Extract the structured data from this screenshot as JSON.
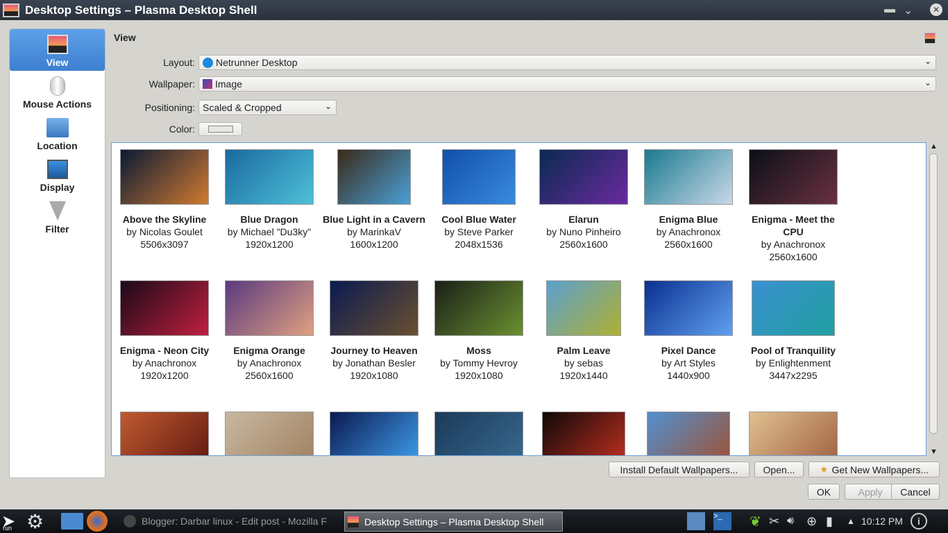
{
  "window": {
    "title": "Desktop Settings – Plasma Desktop Shell"
  },
  "sidebar": {
    "items": [
      {
        "label": "View",
        "icon": "monitor-wallpaper-icon"
      },
      {
        "label": "Mouse Actions",
        "icon": "mouse-icon"
      },
      {
        "label": "Location",
        "icon": "folder-icon"
      },
      {
        "label": "Display",
        "icon": "display-icon"
      },
      {
        "label": "Filter",
        "icon": "filter-icon"
      }
    ]
  },
  "main": {
    "heading": "View",
    "layout": {
      "label": "Layout:",
      "value": "Netrunner Desktop"
    },
    "wallpaper": {
      "label": "Wallpaper:",
      "value": "Image"
    },
    "positioning": {
      "label": "Positioning:",
      "value": "Scaled & Cropped"
    },
    "color": {
      "label": "Color:"
    }
  },
  "wallpapers": [
    {
      "name": "Above the Skyline",
      "author": "by Nicolas Goulet",
      "size": "5506x3097",
      "c": [
        "#0a1a35",
        "#d07a30"
      ]
    },
    {
      "name": "Blue Dragon",
      "author": "by Michael \"Du3ky\"",
      "size": "1920x1200",
      "c": [
        "#1a6aa0",
        "#4ec0d8"
      ]
    },
    {
      "name": "Blue Light in a Cavern",
      "author": "by MarinkaV",
      "size": "1600x1200",
      "c": [
        "#3a2a18",
        "#4aa0d8"
      ]
    },
    {
      "name": "Cool Blue Water",
      "author": "by Steve Parker",
      "size": "2048x1536",
      "c": [
        "#1050a8",
        "#3a8ae0"
      ]
    },
    {
      "name": "Elarun",
      "author": "by Nuno Pinheiro",
      "size": "2560x1600",
      "c": [
        "#0a2a50",
        "#6a2aa0"
      ]
    },
    {
      "name": "Enigma Blue",
      "author": "by Anachronox",
      "size": "2560x1600",
      "c": [
        "#1a7a90",
        "#c8d8e8"
      ]
    },
    {
      "name": "Enigma - Meet the CPU",
      "author": "by Anachronox",
      "size": "2560x1600",
      "c": [
        "#0a1018",
        "#6a3040"
      ]
    },
    {
      "name": "Enigma - Neon City",
      "author": "by Anachronox",
      "size": "1920x1200",
      "c": [
        "#1a0a18",
        "#c02040"
      ]
    },
    {
      "name": "Enigma Orange",
      "author": "by Anachronox",
      "size": "2560x1600",
      "c": [
        "#5a3a80",
        "#e0a080"
      ]
    },
    {
      "name": "Journey to Heaven",
      "author": "by Jonathan Besler",
      "size": "1920x1080",
      "c": [
        "#0a1a50",
        "#6a5030"
      ]
    },
    {
      "name": "Moss",
      "author": "by Tommy Hevroy",
      "size": "1920x1080",
      "c": [
        "#1a2018",
        "#6a9030"
      ]
    },
    {
      "name": "Palm Leave",
      "author": "by sebas",
      "size": "1920x1440",
      "c": [
        "#5aa0d0",
        "#b0b030"
      ]
    },
    {
      "name": "Pixel Dance",
      "author": "by Art Styles",
      "size": "1440x900",
      "c": [
        "#0a3090",
        "#60a0f0"
      ]
    },
    {
      "name": "Pool of Tranquility",
      "author": "by Enlightenment",
      "size": "3447x2295",
      "c": [
        "#3a90d0",
        "#20a0a0"
      ]
    },
    {
      "name": "",
      "author": "",
      "size": "",
      "c": [
        "#c05a30",
        "#601810"
      ]
    },
    {
      "name": "",
      "author": "",
      "size": "",
      "c": [
        "#c8b8a0",
        "#a08060"
      ]
    },
    {
      "name": "",
      "author": "",
      "size": "",
      "c": [
        "#0a1a50",
        "#40a0f0"
      ]
    },
    {
      "name": "",
      "author": "",
      "size": "",
      "c": [
        "#1a3a5a",
        "#3a6a90"
      ]
    },
    {
      "name": "",
      "author": "",
      "size": "",
      "c": [
        "#100808",
        "#c03020"
      ]
    },
    {
      "name": "",
      "author": "",
      "size": "",
      "c": [
        "#5090d0",
        "#a05030"
      ]
    },
    {
      "name": "",
      "author": "",
      "size": "",
      "c": [
        "#e0c090",
        "#a06040"
      ]
    }
  ],
  "buttons": {
    "install": "Install Default Wallpapers...",
    "open": "Open...",
    "get_new": "Get New Wallpapers...",
    "ok": "OK",
    "apply": "Apply",
    "cancel": "Cancel"
  },
  "taskbar": {
    "run": "run",
    "task1": "Blogger: Darbar linux - Edit post - Mozilla F",
    "task2": "Desktop Settings – Plasma Desktop Shell",
    "clock": "10:12 PM"
  }
}
